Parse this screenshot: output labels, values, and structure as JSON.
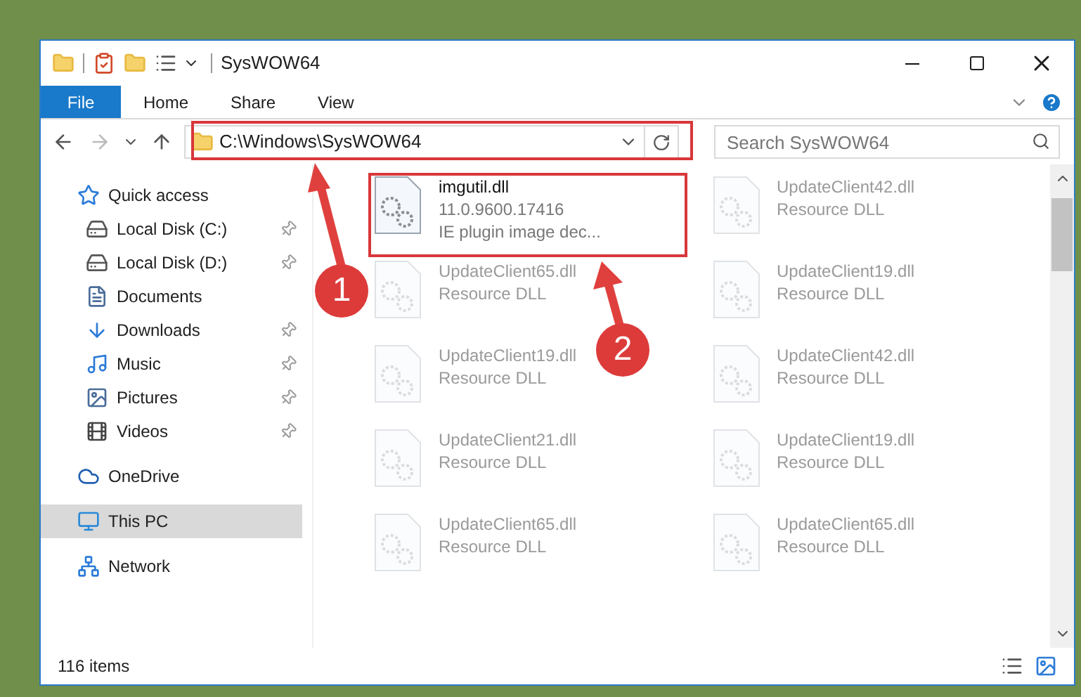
{
  "window": {
    "title": "SysWOW64"
  },
  "ribbon": {
    "tabs": [
      {
        "label": "File",
        "kind": "menu"
      },
      {
        "label": "Home",
        "kind": "tab"
      },
      {
        "label": "Share",
        "kind": "tab"
      },
      {
        "label": "View",
        "kind": "tab"
      }
    ]
  },
  "address_bar": {
    "path": "C:\\Windows\\SysWOW64"
  },
  "search": {
    "placeholder": "Search SysWOW64"
  },
  "nav": {
    "items": [
      {
        "label": "Quick access",
        "kind": "star",
        "pinned": false,
        "selected": false,
        "children": [
          {
            "label": "Local Disk (C:)",
            "kind": "drive",
            "pinned": true,
            "selected": false
          },
          {
            "label": "Local Disk (D:)",
            "kind": "drive",
            "pinned": true,
            "selected": false
          },
          {
            "label": "Documents",
            "kind": "document",
            "pinned": false,
            "selected": false
          },
          {
            "label": "Downloads",
            "kind": "download",
            "pinned": true,
            "selected": false
          },
          {
            "label": "Music",
            "kind": "music",
            "pinned": true,
            "selected": false
          },
          {
            "label": "Pictures",
            "kind": "picture",
            "pinned": true,
            "selected": false
          },
          {
            "label": "Videos",
            "kind": "video",
            "pinned": true,
            "selected": false
          }
        ]
      },
      {
        "label": "OneDrive",
        "kind": "cloud",
        "pinned": false,
        "selected": false
      },
      {
        "label": "This PC",
        "kind": "computer",
        "pinned": false,
        "selected": true
      },
      {
        "label": "Network",
        "kind": "network",
        "pinned": false,
        "selected": false
      }
    ]
  },
  "files": [
    {
      "name": "imgutil.dll",
      "details": [
        "11.0.9600.17416",
        "IE plugin image dec..."
      ],
      "faded": false
    },
    {
      "name": "UpdateClient42.dll",
      "details": [
        "Resource DLL"
      ],
      "faded": true
    },
    {
      "name": "UpdateClient65.dll",
      "details": [
        "Resource DLL"
      ],
      "faded": true
    },
    {
      "name": "UpdateClient19.dll",
      "details": [
        "Resource DLL"
      ],
      "faded": true
    },
    {
      "name": "UpdateClient19.dll",
      "details": [
        "Resource DLL"
      ],
      "faded": true
    },
    {
      "name": "UpdateClient42.dll",
      "details": [
        "Resource DLL"
      ],
      "faded": true
    },
    {
      "name": "UpdateClient21.dll",
      "details": [
        "Resource DLL"
      ],
      "faded": true
    },
    {
      "name": "UpdateClient19.dll",
      "details": [
        "Resource DLL"
      ],
      "faded": true
    },
    {
      "name": "UpdateClient65.dll",
      "details": [
        "Resource DLL"
      ],
      "faded": true
    },
    {
      "name": "UpdateClient65.dll",
      "details": [
        "Resource DLL"
      ],
      "faded": true
    }
  ],
  "status_bar": {
    "item_count": "116 items"
  },
  "annotations": [
    {
      "number": "1"
    },
    {
      "number": "2"
    }
  ]
}
